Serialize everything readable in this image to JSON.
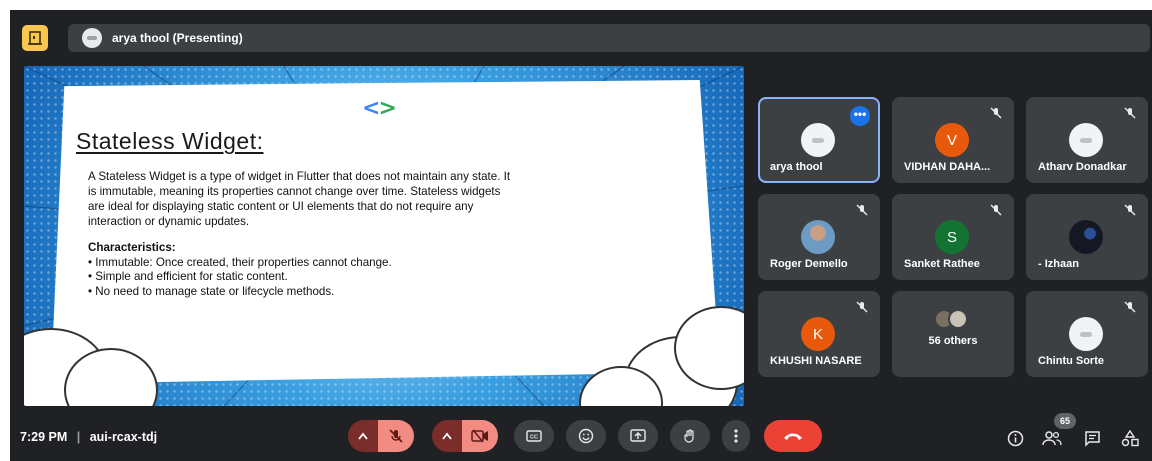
{
  "meeting": {
    "presenter_label": "arya thool (Presenting)",
    "time": "7:29 PM",
    "code": "aui-rcax-tdj",
    "people_count": "65"
  },
  "slide": {
    "logo_left": "<",
    "logo_right": ">",
    "title": "Stateless Widget:",
    "body_lines": [
      "A Stateless Widget is a type of widget in Flutter that does not maintain any state. It",
      "is immutable, meaning its properties cannot change over time. Stateless widgets",
      "are ideal for displaying static content or UI elements that do not require any",
      "interaction or dynamic updates."
    ],
    "char_heading": "Characteristics:",
    "char_lines": [
      "• Immutable: Once created, their properties cannot change.",
      "• Simple and efficient for static content.",
      "• No need to manage state or lifecycle methods."
    ]
  },
  "participants": [
    {
      "name": "arya thool",
      "avatar": "",
      "avatar_type": "logo",
      "muted": false,
      "active": true
    },
    {
      "name": "VIDHAN DAHA...",
      "avatar": "V",
      "avatar_color": "#e8590c",
      "muted": true
    },
    {
      "name": "Atharv Donadkar",
      "avatar": "",
      "avatar_type": "logo",
      "muted": true
    },
    {
      "name": "Roger Demello",
      "avatar": "",
      "avatar_type": "photo",
      "muted": true
    },
    {
      "name": "Sanket Rathee",
      "avatar": "S",
      "avatar_color": "#137333",
      "muted": true
    },
    {
      "name": "- Izhaan",
      "avatar": "",
      "avatar_type": "photo-dark",
      "muted": true
    },
    {
      "name": "KHUSHI NASARE",
      "avatar": "K",
      "avatar_color": "#e8590c",
      "muted": true
    },
    {
      "name": "56 others",
      "avatar": "",
      "avatar_type": "group",
      "muted": false
    },
    {
      "name": "Chintu Sorte",
      "avatar": "",
      "avatar_type": "logo",
      "muted": true
    }
  ],
  "icons": {
    "room": "meeting-room-icon",
    "mic": "mic-off-icon",
    "cam": "camera-off-icon",
    "captions": "captions-icon",
    "emoji": "emoji-icon",
    "present": "present-screen-icon",
    "hand": "raise-hand-icon",
    "more": "more-options-icon",
    "end": "end-call-icon",
    "info": "info-icon",
    "people": "people-icon",
    "chat": "chat-icon",
    "activities": "activities-icon"
  },
  "colors": {
    "background": "#202124",
    "tile": "#3c4043",
    "danger": "#f28b82",
    "end_call": "#ea4335",
    "active_border": "#8ab4f8"
  }
}
